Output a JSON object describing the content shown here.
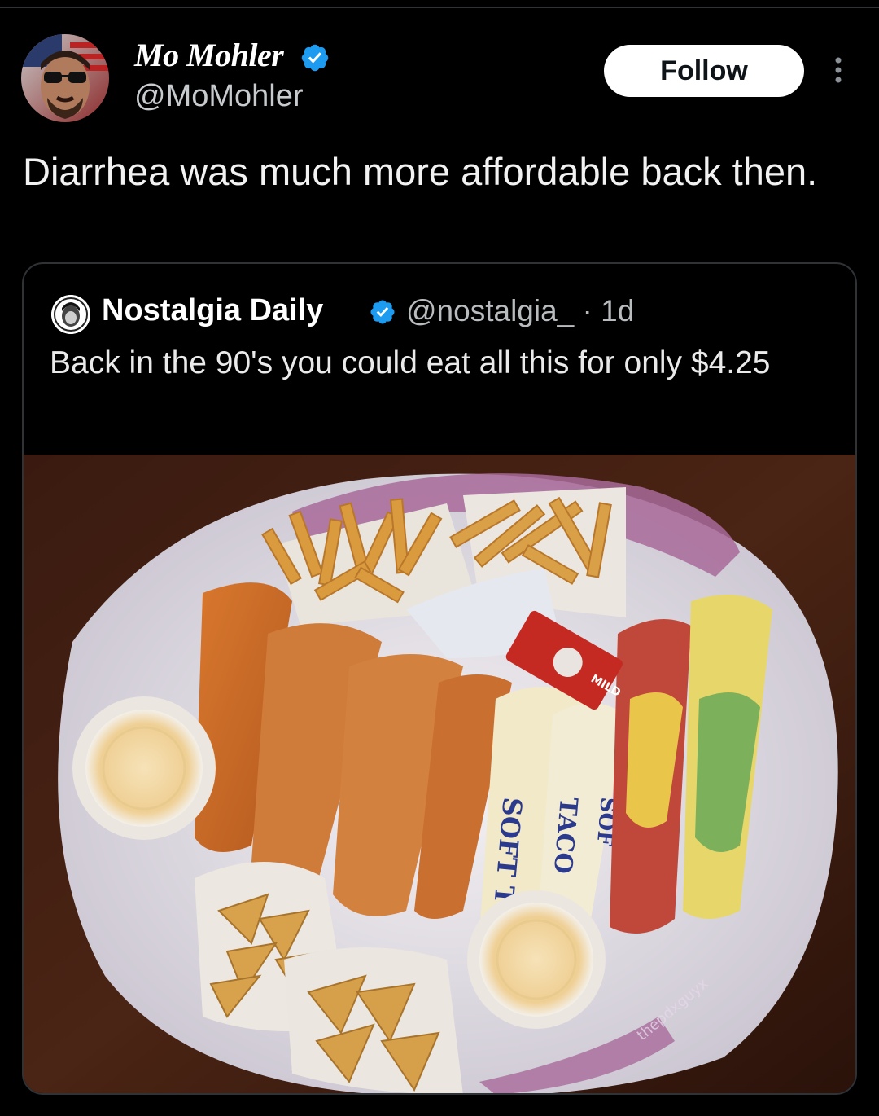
{
  "post": {
    "author_name": "Mo Mohler",
    "author_handle": "@MoMohler",
    "follow_label": "Follow",
    "text": "Diarrhea was much more affordable back then."
  },
  "quoted": {
    "author_name": "Nostalgia Daily",
    "handle_time": "@nostalgia_ · 1d",
    "text": "Back in the 90's you could eat all this for only $4.25",
    "image": {
      "label_soft_left": "SOFT T",
      "label_taco": "TACO",
      "label_soft_right": "SOF",
      "packet_mild": "MILD",
      "watermark": "thepdxguyx"
    }
  },
  "colors": {
    "background": "#000000",
    "verified_blue": "#1d9bf0",
    "follow_bg": "#ffffff"
  },
  "icons": {
    "verified": "verified-badge-icon",
    "more": "more-options-icon"
  }
}
